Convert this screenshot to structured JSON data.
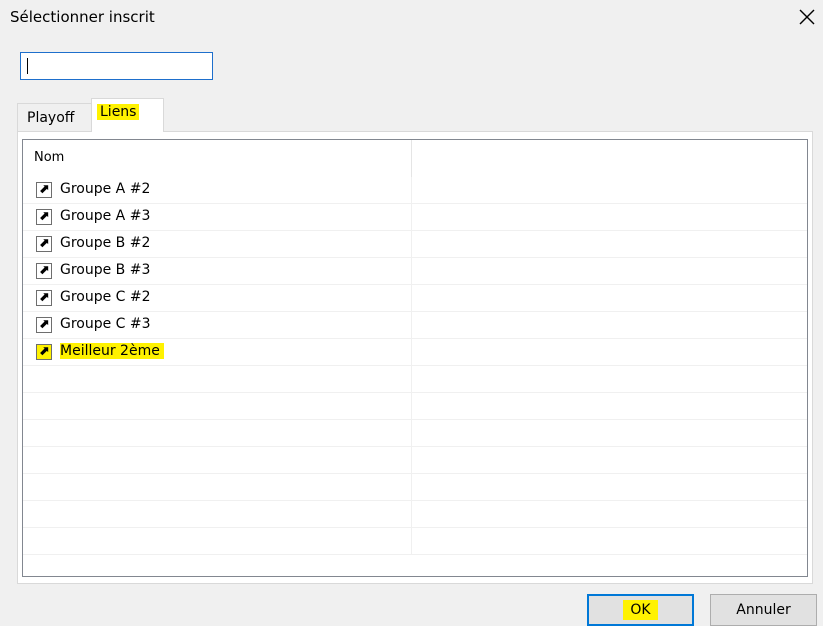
{
  "dialog": {
    "title": "Sélectionner inscrit",
    "close_glyph": "×"
  },
  "search": {
    "value": ""
  },
  "tabs": [
    {
      "label": "Playoff",
      "selected": false
    },
    {
      "label": "Liens",
      "selected": true,
      "highlighted": true
    }
  ],
  "listview": {
    "columns": [
      "Nom",
      ""
    ],
    "icon": "shortcut-arrow-icon",
    "icon_glyph": "⬈",
    "rows": [
      {
        "label": "Groupe A #2",
        "highlighted": false
      },
      {
        "label": "Groupe A #3",
        "highlighted": false
      },
      {
        "label": "Groupe B #2",
        "highlighted": false
      },
      {
        "label": "Groupe B #3",
        "highlighted": false
      },
      {
        "label": "Groupe C #2",
        "highlighted": false
      },
      {
        "label": "Groupe C #3",
        "highlighted": false
      },
      {
        "label": "Meilleur 2ème",
        "highlighted": true
      }
    ]
  },
  "buttons": {
    "ok": "OK",
    "cancel": "Annuler"
  },
  "colors": {
    "highlight": "#fff200",
    "focus_border": "#0078d7"
  }
}
